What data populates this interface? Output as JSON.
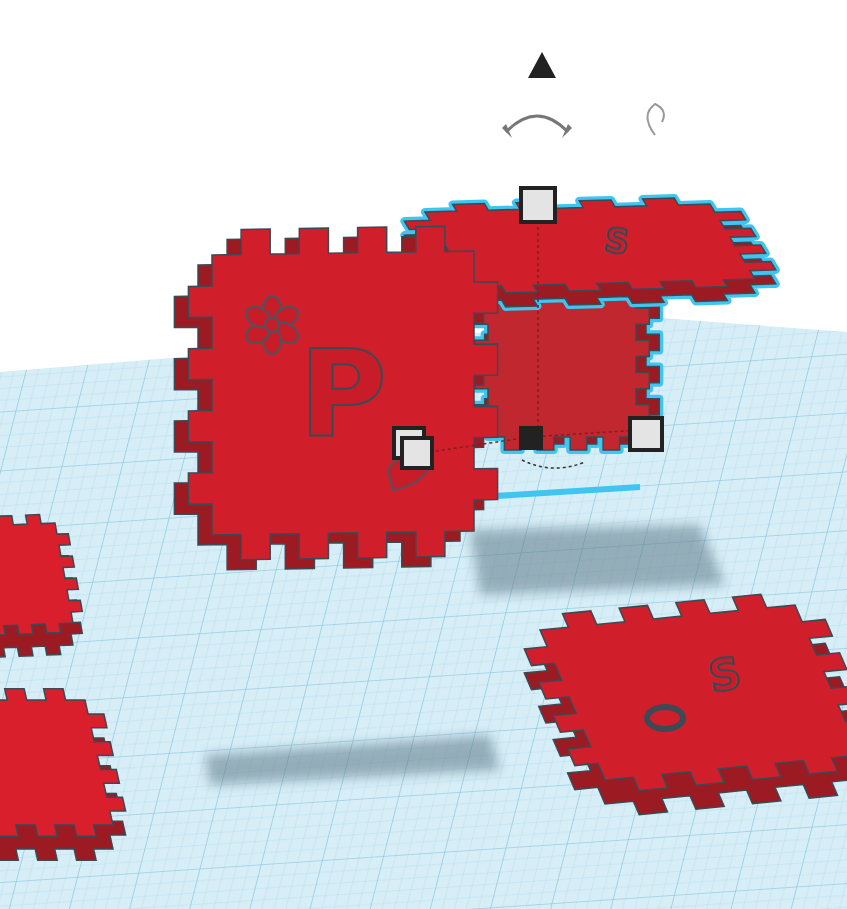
{
  "labeled_shapes": [
    {
      "label": "P",
      "selected": false
    },
    {
      "label": "S",
      "selected": true
    },
    {
      "label": "S",
      "selected": false
    }
  ],
  "plain_shapes": [
    {
      "selected": true
    },
    {
      "selected": false
    },
    {
      "selected": false
    }
  ]
}
